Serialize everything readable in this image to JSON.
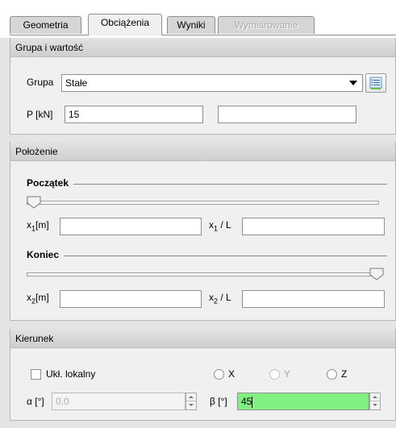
{
  "tabs": [
    {
      "label": "Geometria",
      "state": "normal"
    },
    {
      "label": "Obciążenia",
      "state": "active"
    },
    {
      "label": "Wyniki",
      "state": "normal"
    },
    {
      "label": "Wymiarowanie",
      "state": "disabled"
    }
  ],
  "group_section": {
    "title": "Grupa i wartość",
    "group_label": "Grupa",
    "group_value": "Stałe",
    "p_label": "P [kN]",
    "p_value": "15",
    "p_extra_value": ""
  },
  "position_section": {
    "title": "Położenie",
    "start_title": "Początek",
    "start_slider_fraction": 0.0,
    "x1_label": "x",
    "x1_sub": "1",
    "x1_unit": "[m]",
    "x1_value": "",
    "x1L_label": "x",
    "x1L_sub": "1",
    "x1L_unit": " / L",
    "x1L_value": "",
    "end_title": "Koniec",
    "end_slider_fraction": 1.0,
    "x2_label": "x",
    "x2_sub": "2",
    "x2_unit": "[m]",
    "x2_value": "",
    "x2L_label": "x",
    "x2L_sub": "2",
    "x2L_unit": " / L",
    "x2L_value": ""
  },
  "direction_section": {
    "title": "Kierunek",
    "local_label": "Ukł. lokalny",
    "local_checked": false,
    "radio_x": "X",
    "radio_y": "Y",
    "radio_z": "Z",
    "alpha_label": "α [°]",
    "alpha_value": "0,0",
    "beta_label": "β [°]",
    "beta_value": "45"
  },
  "colors": {
    "active_field": "#80f080",
    "panel_bg": "#f0f0f0"
  }
}
